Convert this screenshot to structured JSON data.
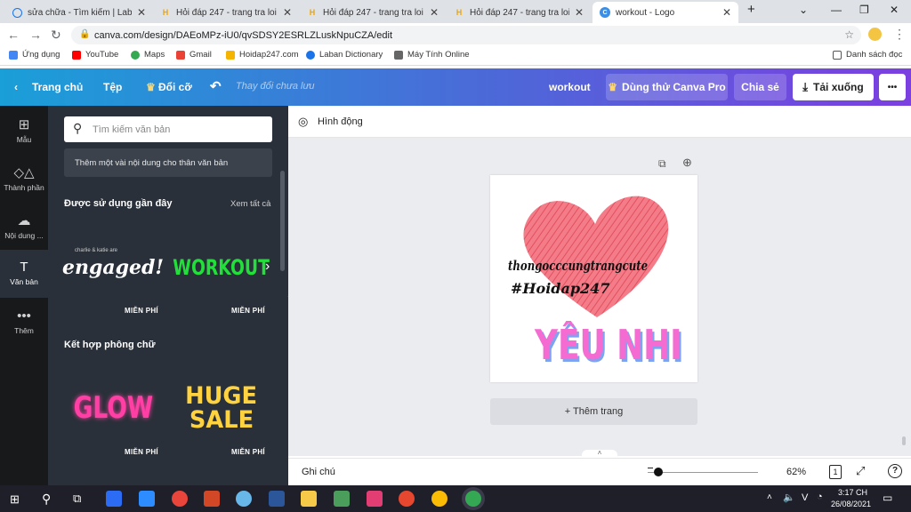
{
  "browser": {
    "tabs": [
      {
        "title": "sửa chữa - Tìm kiếm | Laban Di",
        "favicon": "laban-icon",
        "active": false
      },
      {
        "title": "Hỏi đáp 247 - trang tra loi",
        "favicon": "hoidap-icon",
        "active": false
      },
      {
        "title": "Hỏi đáp 247 - trang tra loi",
        "favicon": "hoidap-icon",
        "active": false
      },
      {
        "title": "Hỏi đáp 247 - trang tra loi",
        "favicon": "hoidap-icon",
        "active": false
      },
      {
        "title": "workout - Logo",
        "favicon": "canva-icon",
        "active": true
      }
    ],
    "url": "canva.com/design/DAEoMPz-iU0/qvSDSY2ESRLZLuskNpuCZA/edit",
    "bookmarks": [
      {
        "label": "Ứng dụng",
        "color": "#4285f4"
      },
      {
        "label": "YouTube",
        "color": "#ff0000"
      },
      {
        "label": "Maps",
        "color": "#34a853"
      },
      {
        "label": "Gmail",
        "color": "#ea4335"
      },
      {
        "label": "Hoidap247.com",
        "color": "#f5b400"
      },
      {
        "label": "Laban Dictionary",
        "color": "#1a73e8"
      },
      {
        "label": "Máy Tính Online",
        "color": "#666666"
      }
    ],
    "reading_list": "Danh sách đọc"
  },
  "header": {
    "home": "Trang chủ",
    "file": "Tệp",
    "resize": "Đổi cỡ",
    "status": "Thay đổi chưa lưu",
    "doc_title": "workout",
    "try_pro": "Dùng thử Canva Pro",
    "share": "Chia sẻ",
    "download": "Tải xuống",
    "more": "•••"
  },
  "rail": [
    {
      "label": "Mẫu",
      "icon": "template-icon"
    },
    {
      "label": "Thành phần",
      "icon": "elements-icon"
    },
    {
      "label": "Nội dung ...",
      "icon": "upload-icon"
    },
    {
      "label": "Văn bản",
      "icon": "text-icon",
      "active": true
    },
    {
      "label": "Thêm",
      "icon": "more-icon"
    }
  ],
  "panel": {
    "search_placeholder": "Tìm kiếm văn bản",
    "add_body": "Thêm một vài nội dung cho thân văn bản",
    "recent_title": "Được sử dụng gần đây",
    "see_all": "Xem tất cả",
    "combo_title": "Kết hợp phông chữ",
    "free": "MIỄN PHÍ",
    "samples": {
      "engaged_small": "charlie & katie are",
      "engaged": "engaged!",
      "workout": "WORKOUT",
      "glow": "GLOW",
      "huge": "HUGE",
      "sale": "SALE"
    }
  },
  "toolbar": {
    "animate": "Hình động"
  },
  "design": {
    "script_line1": "thongocccungtrangcute",
    "script_line2": "#Hoidap247",
    "big_text": "YÊU NHI"
  },
  "canvas": {
    "add_page": "+ Thêm trang"
  },
  "footer": {
    "notes": "Ghi chú",
    "zoom": "62%",
    "page_num": "1",
    "help": "?"
  },
  "taskbar": {
    "time": "3:17 CH",
    "date": "26/08/2021",
    "lang": "V"
  }
}
